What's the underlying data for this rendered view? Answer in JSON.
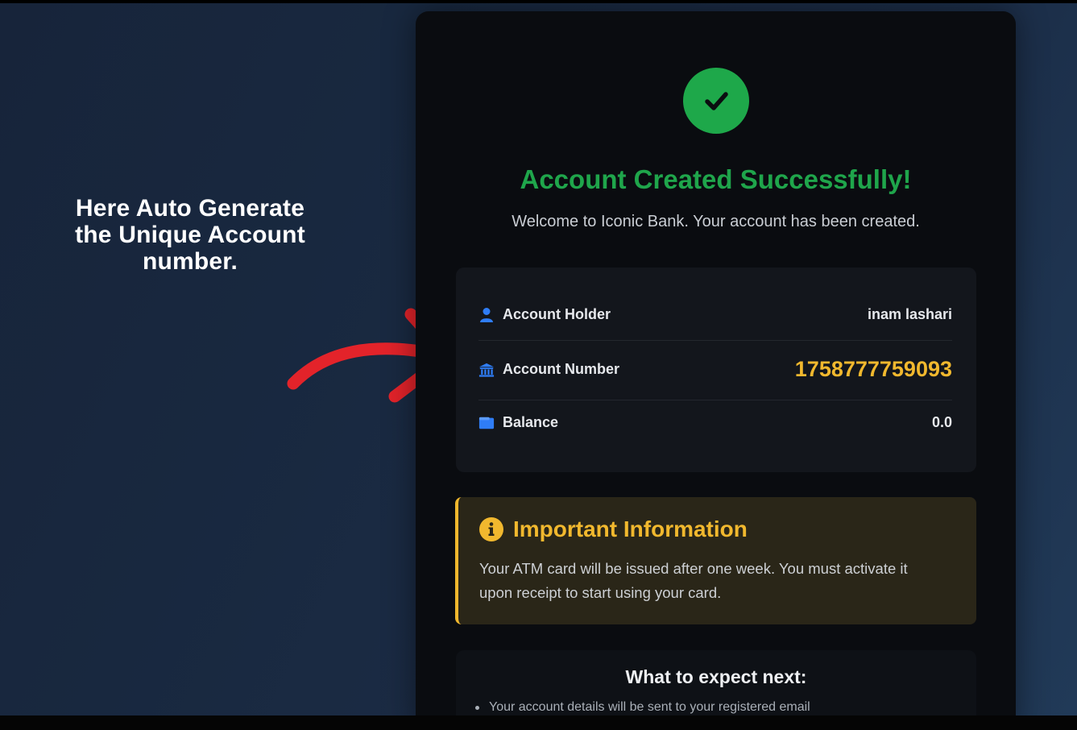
{
  "annotation": {
    "caption_lines": [
      "Here Auto Generate",
      "the Unique Account",
      "number."
    ]
  },
  "card": {
    "title": "Account Created Successfully!",
    "subtitle": "Welcome to Iconic Bank. Your account has been created.",
    "details": [
      {
        "label": "Account Holder",
        "value": "inam lashari",
        "icon": "user-icon"
      },
      {
        "label": "Account Number",
        "value": "1758777759093",
        "icon": "bank-icon"
      },
      {
        "label": "Balance",
        "value": "0.0",
        "icon": "wallet-icon"
      }
    ],
    "info": {
      "title": "Important Information",
      "lines": [
        "Your ATM card will be issued after one week. You must activate it",
        "upon receipt to start using your card."
      ]
    },
    "next": {
      "title": "What to expect next:",
      "items": [
        "Your account details will be sent to your registered email"
      ]
    }
  },
  "colors": {
    "success": "#1ea84a",
    "accent_gold": "#f1b82e",
    "icon_blue": "#2f7df6",
    "arrow_red": "#e3232a"
  }
}
